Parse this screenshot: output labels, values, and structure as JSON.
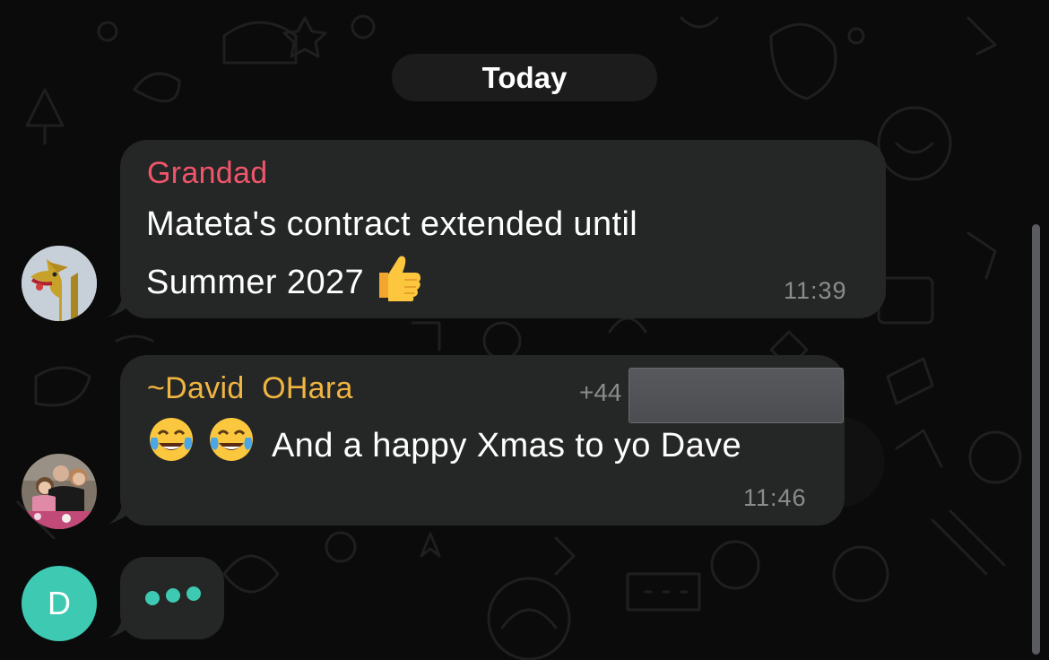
{
  "date_separator": "Today",
  "messages": [
    {
      "sender": "Grandad",
      "sender_color": "#f0556a",
      "line1": "Mateta's contract extended until",
      "line2": "Summer 2027",
      "emoji": "thumbs-up",
      "time": "11:39"
    },
    {
      "sender": "~David  OHara",
      "sender_color": "#f0b541",
      "phone_prefix": "+44",
      "text": "And a happy Xmas to yo Dave",
      "emoji": "face-with-tears-of-joy",
      "time": "11:46"
    }
  ],
  "typing": {
    "avatar_letter": "D",
    "avatar_color": "#3ec9b3"
  },
  "colors": {
    "background": "#0b0b0b",
    "bubble": "#252626",
    "timestamp": "#8b8c8e",
    "date_pill": "#1c1c1d"
  }
}
